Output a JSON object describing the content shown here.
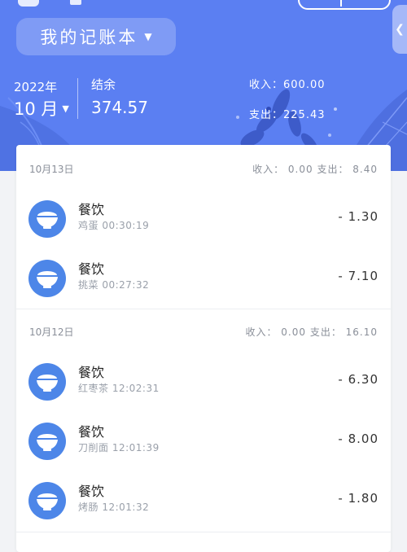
{
  "header": {
    "book_label": "我的记账本",
    "year": "2022年",
    "month": "10 月",
    "balance_label": "结余",
    "balance_value": "374.57",
    "income_total": "收入：600.00",
    "expense_total": "支出：225.43"
  },
  "groups": [
    {
      "date": "10月13日",
      "summary": "收入： 0.00   支出： 8.40",
      "items": [
        {
          "category": "餐饮",
          "note": "鸡蛋",
          "time": "00:30:19",
          "amount": "- 1.30"
        },
        {
          "category": "餐饮",
          "note": "挑菜",
          "time": "00:27:32",
          "amount": "- 7.10"
        }
      ]
    },
    {
      "date": "10月12日",
      "summary": "收入： 0.00   支出： 16.10",
      "items": [
        {
          "category": "餐饮",
          "note": "红枣茶",
          "time": "12:02:31",
          "amount": "- 6.30"
        },
        {
          "category": "餐饮",
          "note": "刀削面",
          "time": "12:01:39",
          "amount": "- 8.00"
        },
        {
          "category": "餐饮",
          "note": "烤肠",
          "time": "12:01:32",
          "amount": "- 1.80"
        }
      ]
    }
  ],
  "icons": {
    "category": "bowl-icon",
    "book_caret": "caret-down-icon",
    "month_caret": "caret-down-icon"
  },
  "colors": {
    "header_bg": "#5b7ff2",
    "icon_bg": "#4d86e8"
  }
}
